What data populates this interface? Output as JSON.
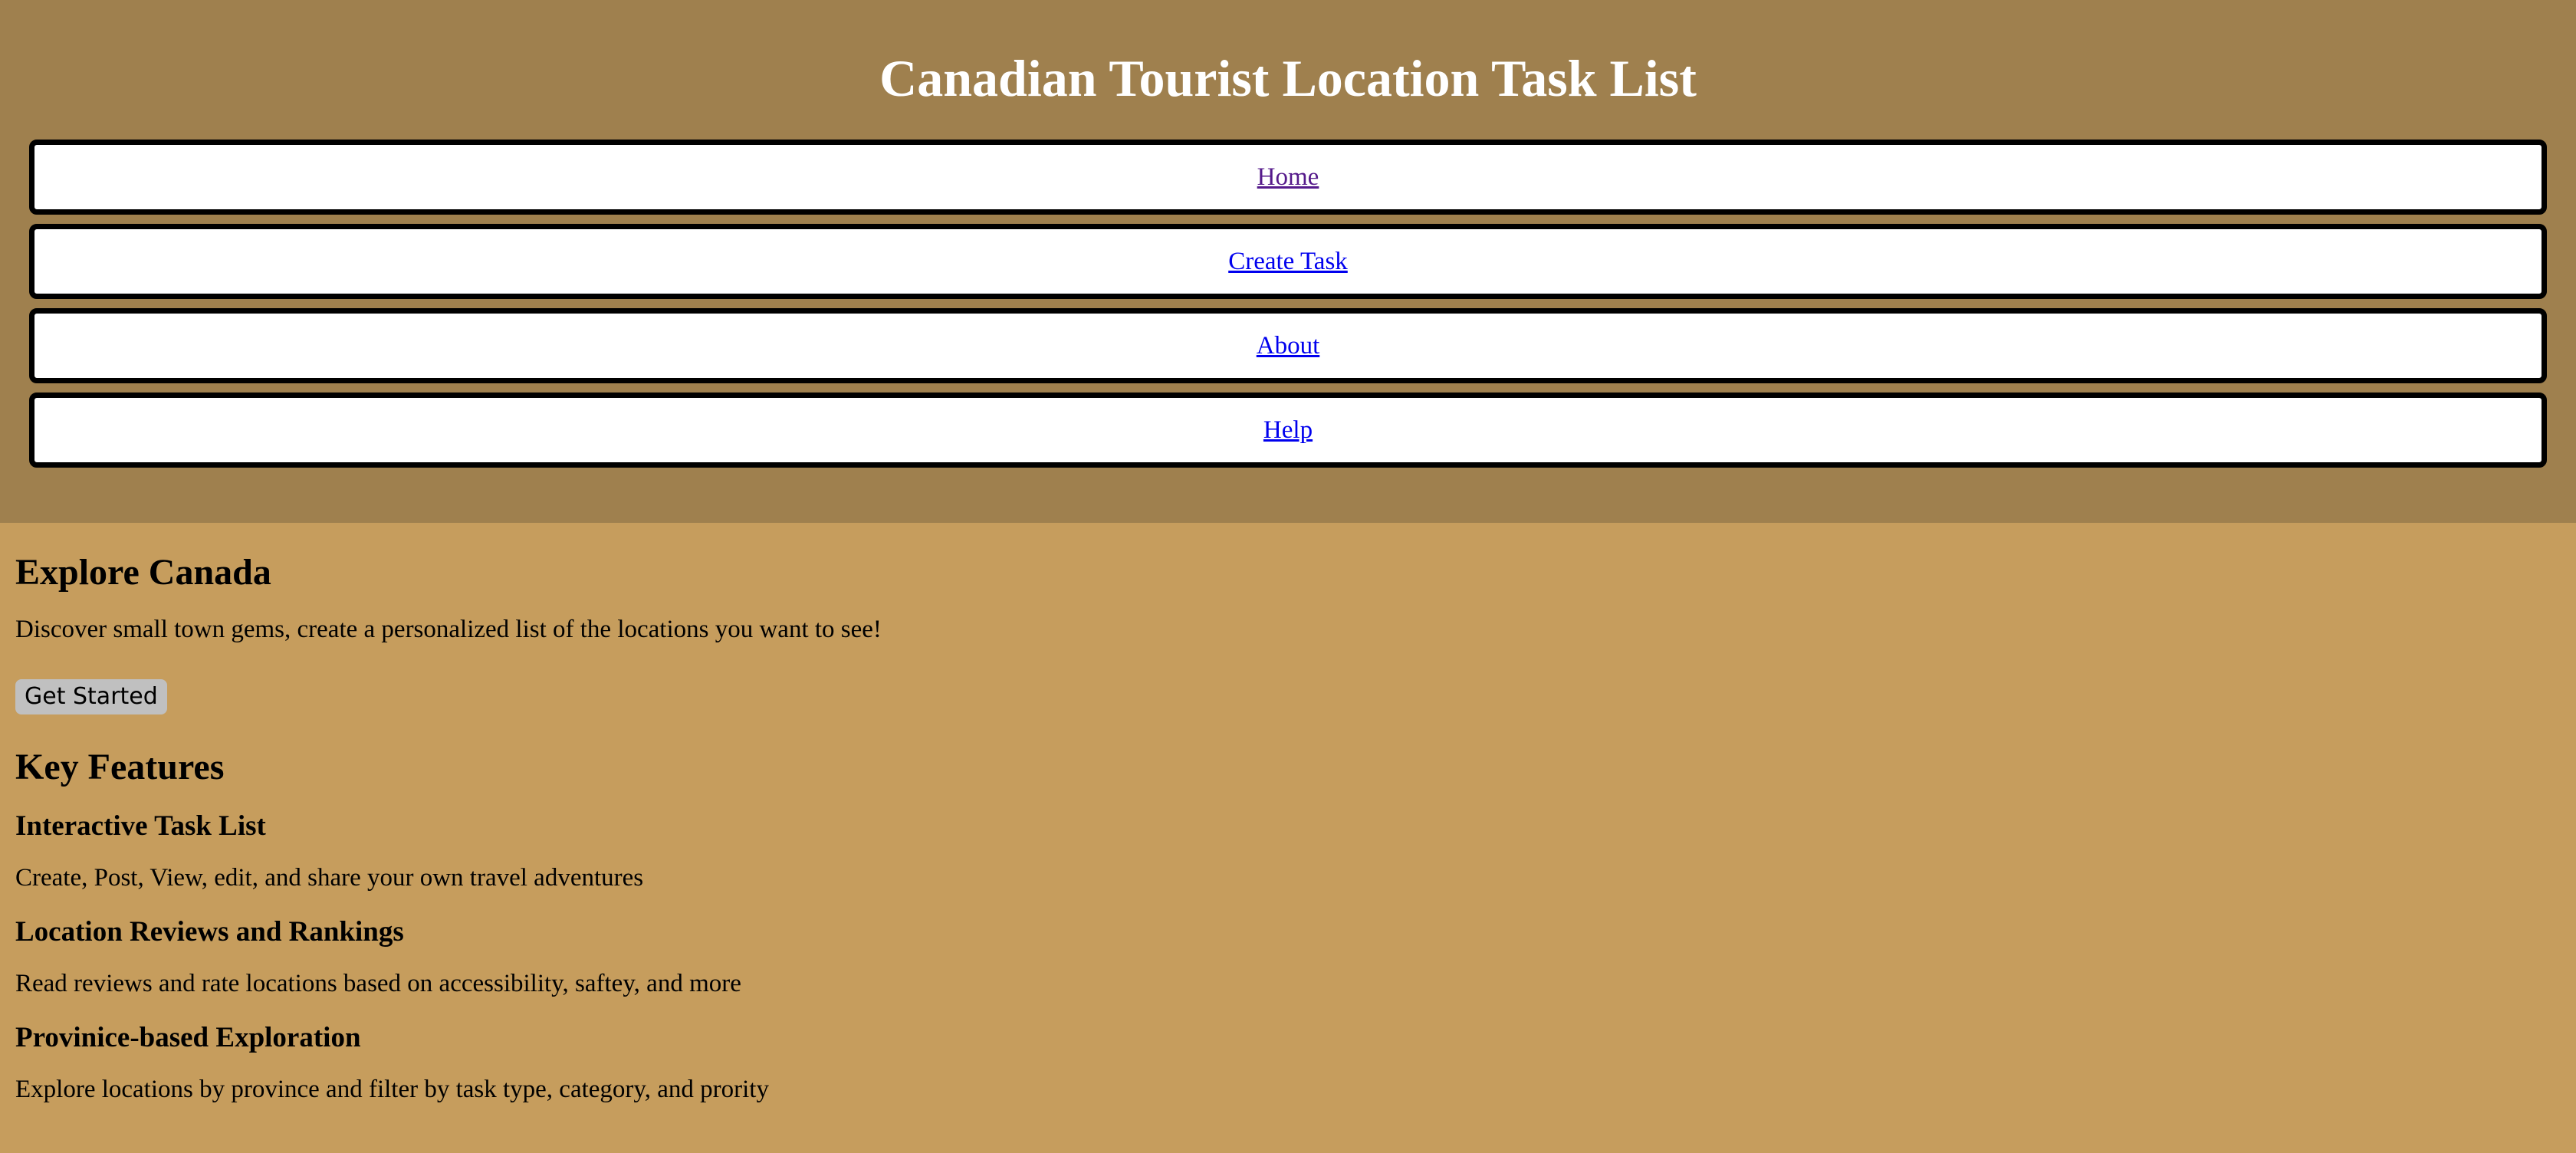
{
  "header": {
    "title": "Canadian Tourist Location Task List",
    "nav": [
      {
        "label": "Home",
        "visited": true
      },
      {
        "label": "Create Task",
        "visited": false
      },
      {
        "label": "About",
        "visited": false
      },
      {
        "label": "Help",
        "visited": false
      }
    ]
  },
  "hero": {
    "title": "Explore Canada",
    "text": "Discover small town gems, create a personalized list of the locations you want to see!",
    "button_label": "Get Started"
  },
  "features": {
    "title": "Key Features",
    "items": [
      {
        "title": "Interactive Task List",
        "description": "Create, Post, View, edit, and share your own travel adventures"
      },
      {
        "title": "Location Reviews and Rankings",
        "description": "Read reviews and rate locations based on accessibility, saftey, and more"
      },
      {
        "title": "Provinice-based Exploration",
        "description": "Explore locations by province and filter by task type, category, and prority"
      }
    ]
  },
  "colors": {
    "header_background": "#9f804e",
    "page_background": "#c69d5d",
    "link": "#0000ee",
    "visited_link": "#551a8b",
    "button_background": "#c0c0c0"
  }
}
